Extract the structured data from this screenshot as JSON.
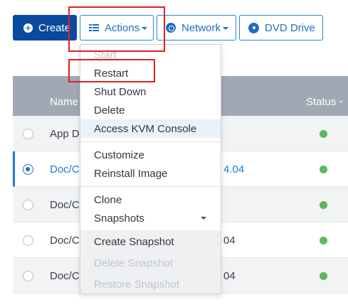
{
  "toolbar": {
    "create_label": "Create",
    "actions_label": "Actions",
    "network_label": "Network",
    "dvd_label": "DVD Drive"
  },
  "table": {
    "columns": {
      "name": "Name",
      "status": "Status"
    },
    "rows": [
      {
        "name": "App De",
        "version": "",
        "selected": false,
        "status": "running"
      },
      {
        "name": "Doc/Co",
        "version": "4.04",
        "selected": true,
        "status": "running"
      },
      {
        "name": "Doc/Co",
        "version": "",
        "selected": false,
        "status": "running"
      },
      {
        "name": "Doc/Co",
        "version": "04",
        "selected": false,
        "status": "running"
      },
      {
        "name": "Doc/Co",
        "version": "04",
        "selected": false,
        "status": "running"
      }
    ]
  },
  "actions_menu": {
    "items": [
      {
        "label": "Start",
        "disabled": true
      },
      {
        "label": "Restart",
        "disabled": false
      },
      {
        "label": "Shut Down",
        "disabled": false
      },
      {
        "label": "Delete",
        "disabled": false
      },
      {
        "label": "Access KVM Console",
        "disabled": false,
        "highlighted": true
      },
      {
        "label": "Customize",
        "disabled": false
      },
      {
        "label": "Reinstall Image",
        "disabled": false
      },
      {
        "label": "Clone",
        "disabled": false
      },
      {
        "label": "Snapshots",
        "disabled": false,
        "has_submenu": true
      },
      {
        "label": "Create Snapshot",
        "disabled": false
      },
      {
        "label": "Delete Snapshot",
        "disabled": true
      },
      {
        "label": "Restore Snapshot",
        "disabled": true
      }
    ]
  },
  "colors": {
    "primary": "#0a4a9e",
    "accent": "#1f6fc4",
    "header_bg": "#a0a8b4",
    "status_green": "#5cb85c",
    "annotation_red": "#e02020"
  },
  "icons": {
    "create": "plus-circle-icon",
    "actions": "list-icon",
    "network": "network-icon",
    "dvd": "disc-icon"
  }
}
